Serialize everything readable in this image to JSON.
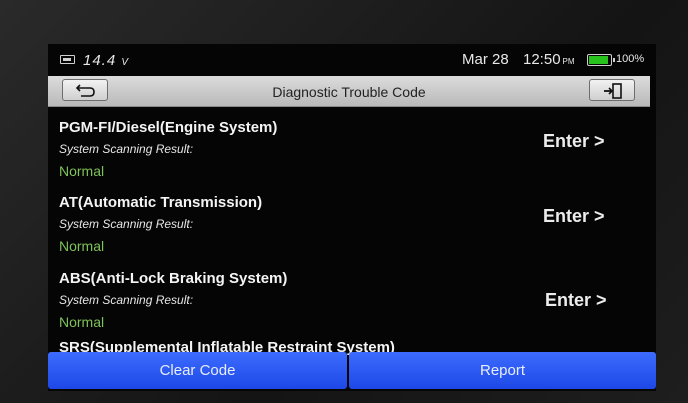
{
  "status": {
    "voltage_value": "14.4",
    "voltage_unit": "V",
    "date": "Mar 28",
    "time": "12:50",
    "ampm": "PM",
    "battery_level": 1.0,
    "battery_pct": "100%",
    "colors": {
      "battery": "#27c21c"
    }
  },
  "header": {
    "title": "Diagnostic Trouble Code",
    "back_icon": "back-arrow-icon",
    "exit_icon": "exit-icon"
  },
  "systems": [
    {
      "name": "PGM-FI/Diesel(Engine System)",
      "sub": "System Scanning Result:",
      "result": "Normal",
      "action": "Enter >"
    },
    {
      "name": "AT(Automatic Transmission)",
      "sub": "System Scanning Result:",
      "result": "Normal",
      "action": "Enter >"
    },
    {
      "name": "ABS(Anti-Lock Braking System)",
      "sub": "System Scanning Result:",
      "result": "Normal",
      "action": "Enter >"
    },
    {
      "name": "SRS(Supplemental Inflatable Restraint System)"
    }
  ],
  "buttons": {
    "clear_code": "Clear Code",
    "report": "Report"
  },
  "colors": {
    "normal_status": "#7ec25a",
    "button": "#2a5bf5"
  }
}
